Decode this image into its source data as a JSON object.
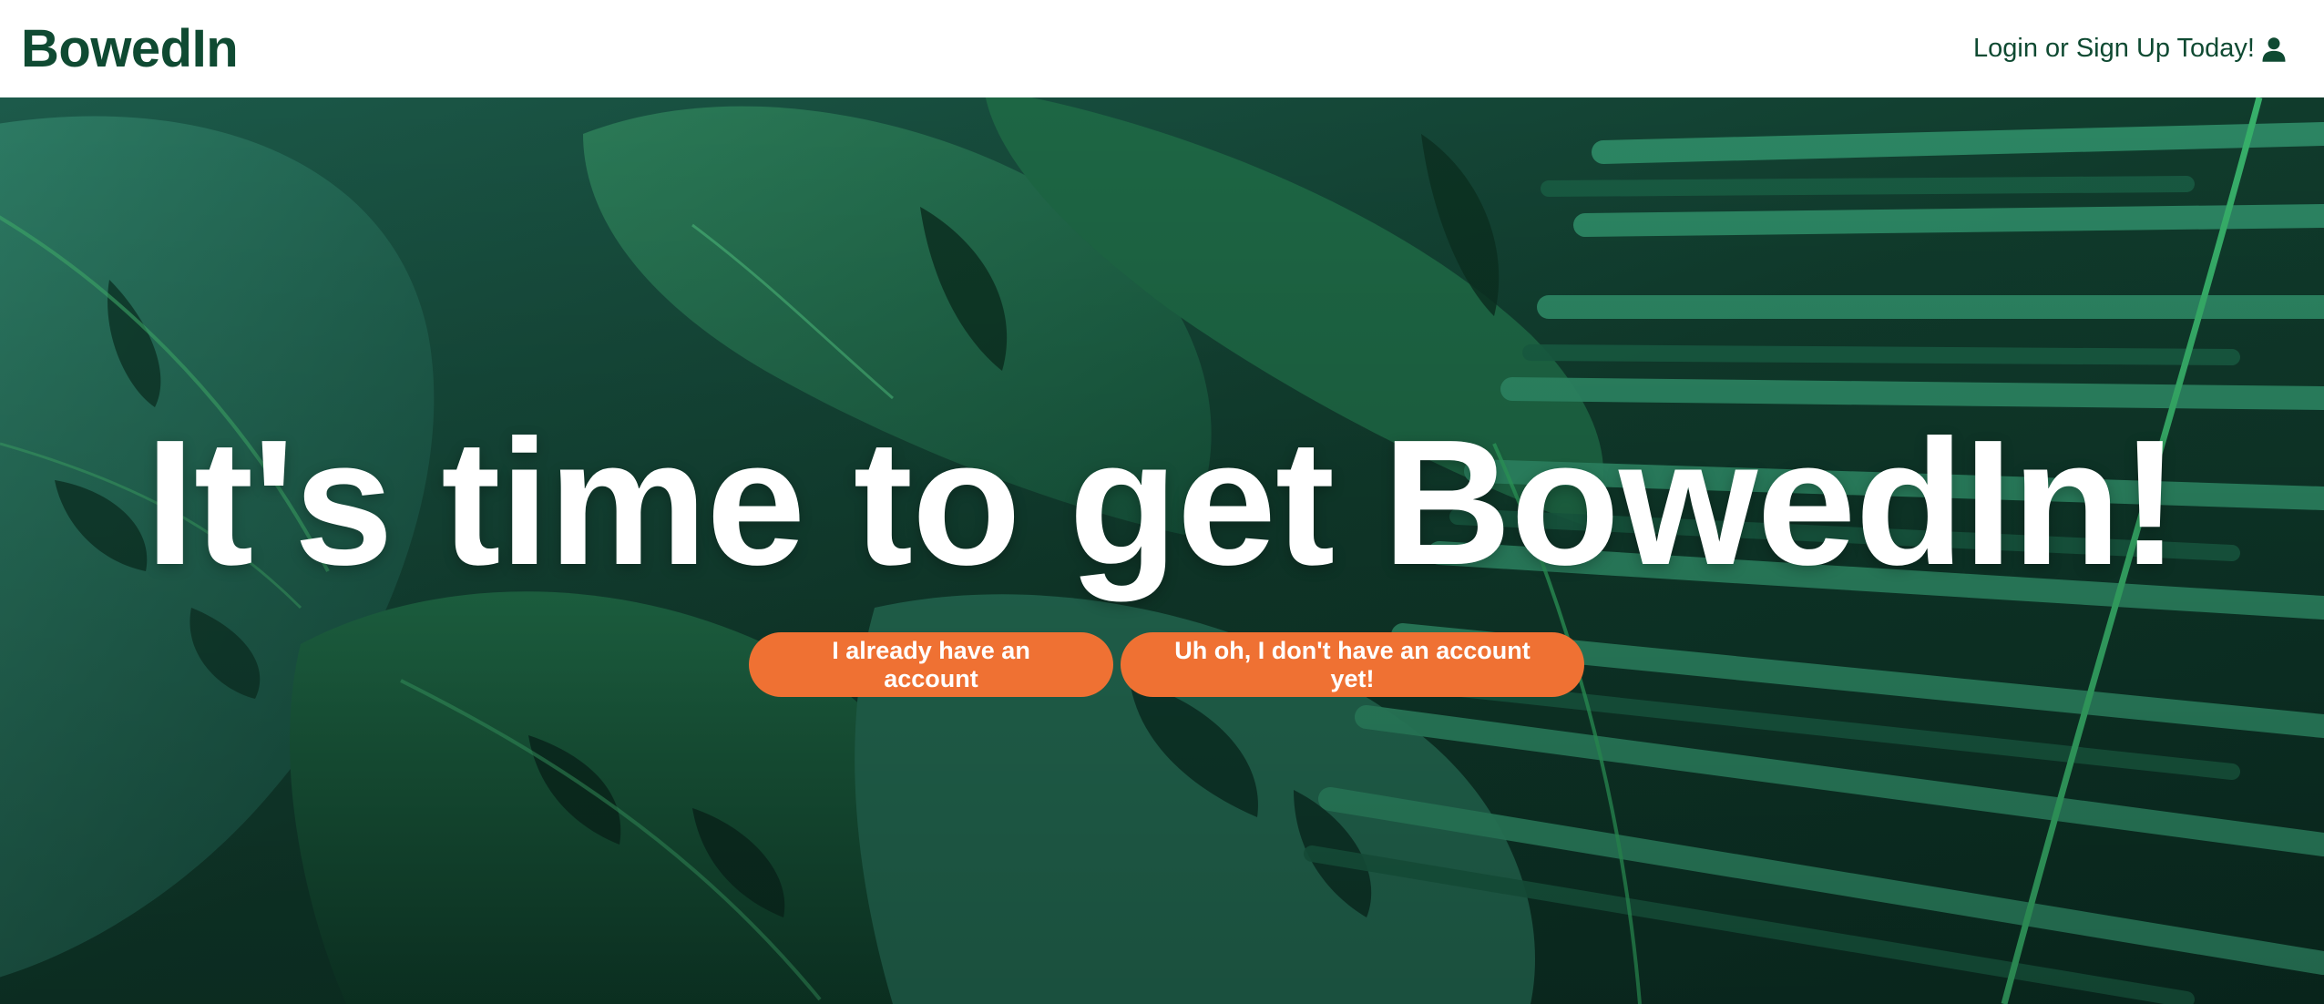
{
  "navbar": {
    "brand": "BowedIn",
    "login_label": "Login or Sign Up Today!",
    "login_icon": "user-icon"
  },
  "hero": {
    "title": "It's time to get BowedIn!",
    "background": "tropical-leaves-photo",
    "buttons": {
      "existing_account": "I already have an account",
      "new_account": "Uh oh, I don't have an account yet!"
    }
  },
  "colors": {
    "brand_green": "#0f4a32",
    "accent_orange": "#ef7133",
    "text_white": "#ffffff"
  }
}
